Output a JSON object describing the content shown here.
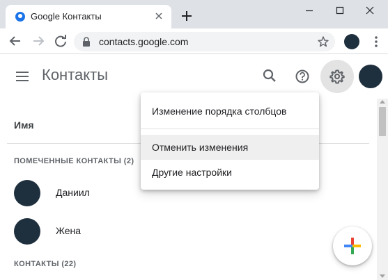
{
  "browser": {
    "tab_title": "Google Контакты",
    "url": "contacts.google.com"
  },
  "app": {
    "title": "Контакты"
  },
  "list": {
    "column_header": "Имя",
    "starred_label": "ПОМЕЧЕННЫЕ КОНТАКТЫ (2)",
    "contacts_label": "КОНТАКТЫ (22)",
    "starred": [
      {
        "name": "Даниил"
      },
      {
        "name": "Жена"
      }
    ]
  },
  "settings_menu": {
    "items": [
      {
        "label": "Изменение порядка столбцов"
      },
      {
        "label": "Отменить изменения"
      },
      {
        "label": "Другие настройки"
      }
    ],
    "highlighted_index": 1
  },
  "colors": {
    "avatar": "#1e2f3e",
    "chrome": "#dee1e6",
    "menu_highlight": "#efefef"
  },
  "icons": {
    "tab_close": "close-icon",
    "new_tab": "plus-icon",
    "back": "arrow-left-icon",
    "forward": "arrow-right-icon",
    "reload": "reload-icon",
    "lock": "lock-icon",
    "bookmark": "star-icon",
    "menu": "hamburger-icon",
    "search": "search-icon",
    "help": "help-icon",
    "settings": "gear-icon",
    "create": "plus-multicolor-icon"
  }
}
